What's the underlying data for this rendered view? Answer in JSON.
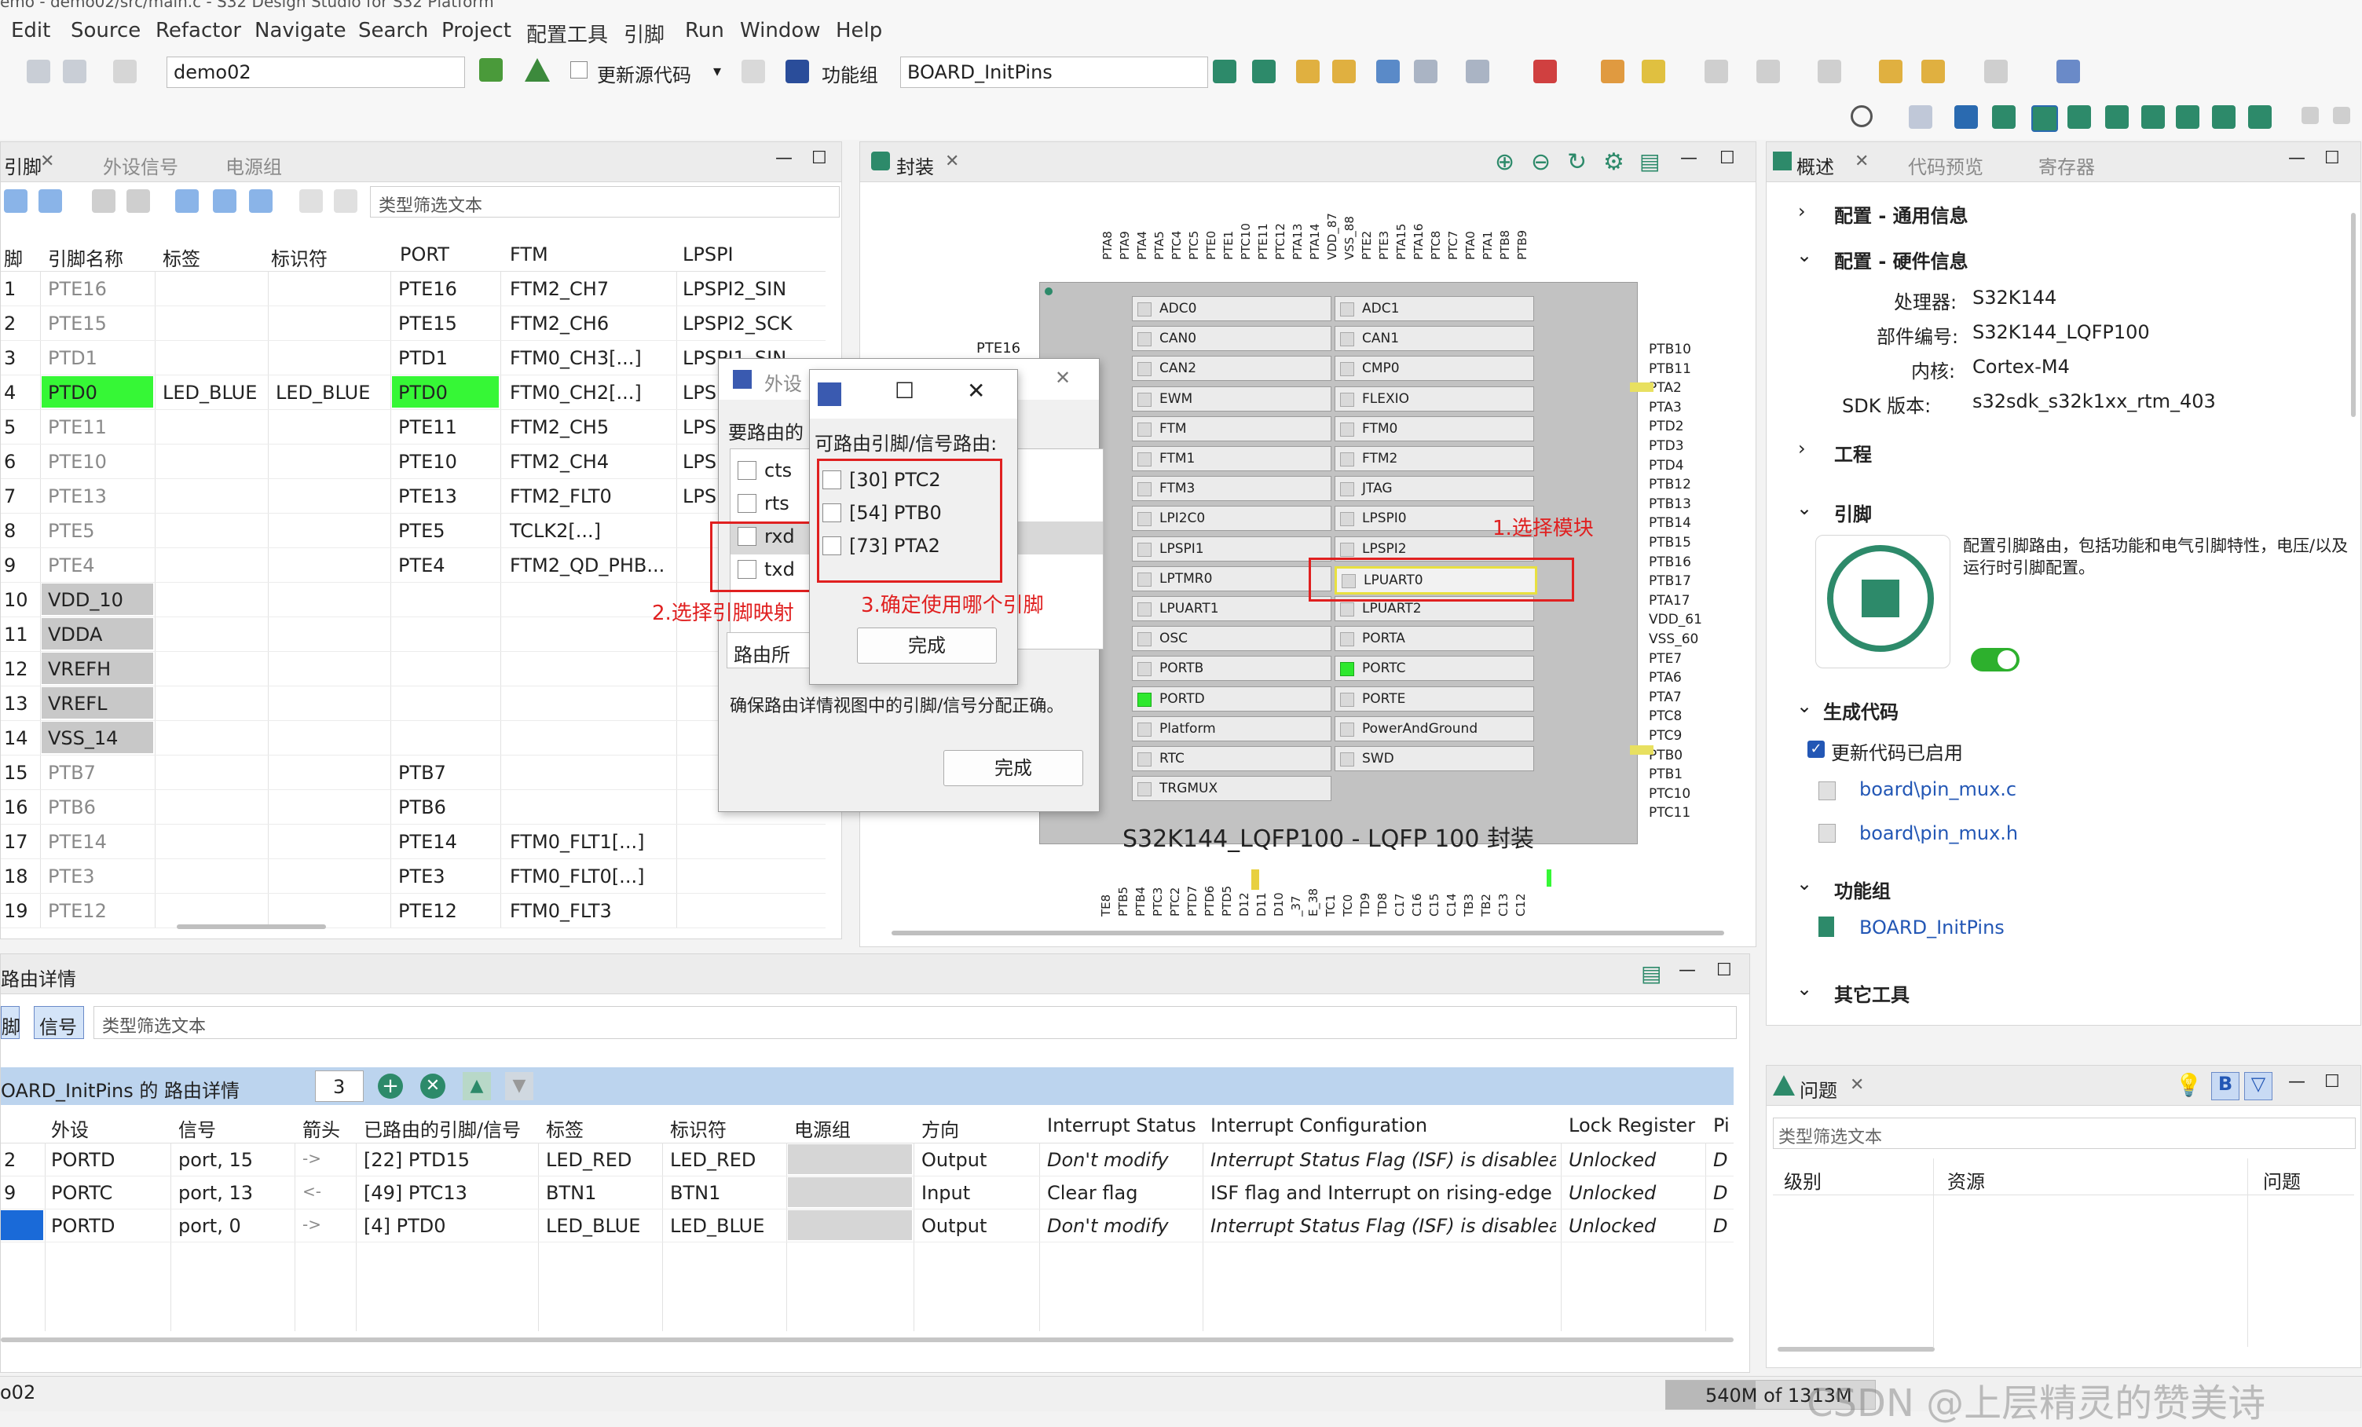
{
  "window": {
    "title": "emo - demo02/src/main.c - S32 Design Studio for S32 Platform"
  },
  "menu": [
    "Edit",
    "Source",
    "Refactor",
    "Navigate",
    "Search",
    "Project",
    "配置工具",
    "引脚",
    "Run",
    "Window",
    "Help"
  ],
  "toolbar": {
    "project": "demo02",
    "update_code": "更新源代码",
    "function_group_label": "功能组",
    "function_group": "BOARD_InitPins"
  },
  "pins_panel": {
    "tabs": [
      "引脚",
      "外设信号",
      "电源组"
    ],
    "filter_placeholder": "类型筛选文本",
    "columns": [
      "脚",
      "引脚名称",
      "标签",
      "标识符",
      "PORT",
      "FTM",
      "LPSPI"
    ],
    "rows": [
      {
        "n": "1",
        "name": "PTE16",
        "label": "",
        "id": "",
        "port": "PTE16",
        "ftm": "FTM2_CH7",
        "lpspi": "LPSPI2_SIN"
      },
      {
        "n": "2",
        "name": "PTE15",
        "label": "",
        "id": "",
        "port": "PTE15",
        "ftm": "FTM2_CH6",
        "lpspi": "LPSPI2_SCK"
      },
      {
        "n": "3",
        "name": "PTD1",
        "label": "",
        "id": "",
        "port": "PTD1",
        "ftm": "FTM0_CH3[...]",
        "lpspi": "LPSPI1_SIN"
      },
      {
        "n": "4",
        "name": "PTD0",
        "label": "LED_BLUE",
        "id": "LED_BLUE",
        "port": "PTD0",
        "ftm": "FTM0_CH2[...]",
        "lpspi": "LPSP"
      },
      {
        "n": "5",
        "name": "PTE11",
        "label": "",
        "id": "",
        "port": "PTE11",
        "ftm": "FTM2_CH5",
        "lpspi": "LPSP"
      },
      {
        "n": "6",
        "name": "PTE10",
        "label": "",
        "id": "",
        "port": "PTE10",
        "ftm": "FTM2_CH4",
        "lpspi": "LPSP"
      },
      {
        "n": "7",
        "name": "PTE13",
        "label": "",
        "id": "",
        "port": "PTE13",
        "ftm": "FTM2_FLT0",
        "lpspi": "LPSP"
      },
      {
        "n": "8",
        "name": "PTE5",
        "label": "",
        "id": "",
        "port": "PTE5",
        "ftm": "TCLK2[...]",
        "lpspi": ""
      },
      {
        "n": "9",
        "name": "PTE4",
        "label": "",
        "id": "",
        "port": "PTE4",
        "ftm": "FTM2_QD_PHB...",
        "lpspi": ""
      },
      {
        "n": "10",
        "name": "VDD_10",
        "label": "",
        "id": "",
        "port": "",
        "ftm": "",
        "lpspi": ""
      },
      {
        "n": "11",
        "name": "VDDA",
        "label": "",
        "id": "",
        "port": "",
        "ftm": "",
        "lpspi": ""
      },
      {
        "n": "12",
        "name": "VREFH",
        "label": "",
        "id": "",
        "port": "",
        "ftm": "",
        "lpspi": ""
      },
      {
        "n": "13",
        "name": "VREFL",
        "label": "",
        "id": "",
        "port": "",
        "ftm": "",
        "lpspi": ""
      },
      {
        "n": "14",
        "name": "VSS_14",
        "label": "",
        "id": "",
        "port": "",
        "ftm": "",
        "lpspi": ""
      },
      {
        "n": "15",
        "name": "PTB7",
        "label": "",
        "id": "",
        "port": "PTB7",
        "ftm": "",
        "lpspi": ""
      },
      {
        "n": "16",
        "name": "PTB6",
        "label": "",
        "id": "",
        "port": "PTB6",
        "ftm": "",
        "lpspi": ""
      },
      {
        "n": "17",
        "name": "PTE14",
        "label": "",
        "id": "",
        "port": "PTE14",
        "ftm": "FTM0_FLT1[...]",
        "lpspi": ""
      },
      {
        "n": "18",
        "name": "PTE3",
        "label": "",
        "id": "",
        "port": "PTE3",
        "ftm": "FTM0_FLT0[...]",
        "lpspi": ""
      },
      {
        "n": "19",
        "name": "PTE12",
        "label": "",
        "id": "",
        "port": "PTE12",
        "ftm": "FTM0_FLT3",
        "lpspi": ""
      }
    ]
  },
  "package_panel": {
    "tab": "封装",
    "package_title": "S32K144_LQFP100 - LQFP 100 封装",
    "top_pins": [
      "PTA8",
      "PTA9",
      "PTA4",
      "PTA5",
      "PTC4",
      "PTC5",
      "PTE0",
      "PTE1",
      "PTC10",
      "PTE11",
      "PTC12",
      "PTA13",
      "PTA14",
      "VDD_87",
      "VSS_88",
      "PTE2",
      "PTE3",
      "PTA15",
      "PTA16",
      "PTC8",
      "PTC7",
      "PTA0",
      "PTA1",
      "PTB8",
      "PTB9"
    ],
    "bottom_pins": [
      "TE8",
      "PTB5",
      "PTB4",
      "PTC3",
      "PTC2",
      "PTD7",
      "PTD6",
      "PTD5",
      "D12",
      "D11",
      "D10",
      "_37",
      "E_38",
      "TC1",
      "TC0",
      "TD9",
      "TD8",
      "C17",
      "C16",
      "C15",
      "C14",
      "TB3",
      "TB2",
      "C13",
      "C12"
    ],
    "right_pins": [
      "PTB10",
      "PTB11",
      "PTA2",
      "PTA3",
      "PTD2",
      "PTD3",
      "PTD4",
      "PTB12",
      "PTB13",
      "PTB14",
      "PTB15",
      "PTB16",
      "PTB17",
      "PTA17",
      "VDD_61",
      "VSS_60",
      "PTE7",
      "PTA6",
      "PTA7",
      "PTC8",
      "PTC9",
      "PTB0",
      "PTB1",
      "PTC10",
      "PTC11"
    ],
    "left_pin": "PTE16",
    "modules_left": [
      "ADC0",
      "CAN0",
      "CAN2",
      "EWM",
      "FTM",
      "FTM1",
      "FTM3",
      "LPI2C0",
      "LPSPI1",
      "LPTMR0",
      "LPUART1",
      "OSC",
      "PORTB",
      "PORTD",
      "Platform",
      "RTC",
      "TRGMUX"
    ],
    "modules_right": [
      "ADC1",
      "CAN1",
      "CMP0",
      "FLEXIO",
      "FTM0",
      "FTM2",
      "JTAG",
      "LPSPI0",
      "LPSPI2",
      "LPUART0",
      "LPUART2",
      "PORTA",
      "PORTC",
      "PORTE",
      "PowerAndGround",
      "SWD"
    ]
  },
  "annotations": {
    "step1": "1.选择模块",
    "step2": "2.选择引脚映射",
    "step3": "3.确定使用哪个引脚"
  },
  "dialog_signals": {
    "title": "外设",
    "prompt": "要路由的",
    "signals": [
      "cts",
      "rts",
      "rxd",
      "txd"
    ],
    "route_label": "路由所",
    "hint": "确保路由详情视图中的引脚/信号分配正确。",
    "done": "完成"
  },
  "dialog_pins": {
    "prompt": "可路由引脚/信号路由:",
    "options": [
      "[30] PTC2",
      "[54] PTB0",
      "[73] PTA2"
    ],
    "done": "完成"
  },
  "overview_panel": {
    "tabs": [
      "概述",
      "代码预览",
      "寄存器"
    ],
    "sections": {
      "general": "配置 - 通用信息",
      "hardware": "配置 - 硬件信息",
      "project": "工程",
      "pins": "引脚",
      "gen_code": "生成代码",
      "func_group": "功能组",
      "other_tools": "其它工具"
    },
    "hw": [
      {
        "k": "处理器:",
        "v": "S32K144"
      },
      {
        "k": "部件编号:",
        "v": "S32K144_LQFP100"
      },
      {
        "k": "内核:",
        "v": "Cortex-M4"
      },
      {
        "k": "SDK 版本:",
        "v": "s32sdk_s32k1xx_rtm_403"
      }
    ],
    "pins_desc": "配置引脚路由，包括功能和电气引脚特性，电压/以及运行时引脚配置。",
    "gen_enabled": "更新代码已启用",
    "files": [
      "board\\pin_mux.c",
      "board\\pin_mux.h"
    ],
    "func_group": "BOARD_InitPins"
  },
  "problems_panel": {
    "tab": "问题",
    "filter_placeholder": "类型筛选文本",
    "columns": [
      "级别",
      "资源",
      "问题"
    ]
  },
  "routing_panel": {
    "title": "路由详情",
    "tabs": [
      "脚",
      "信号"
    ],
    "filter_placeholder": "类型筛选文本",
    "header": "OARD_InitPins 的 路由详情",
    "count": "3",
    "columns": [
      "外设",
      "信号",
      "箭头",
      "已路由的引脚/信号",
      "标签",
      "标识符",
      "电源组",
      "方向",
      "Interrupt Status",
      "Interrupt Configuration",
      "Lock Register",
      "Pi"
    ],
    "rows": [
      {
        "n": "2",
        "periph": "PORTD",
        "signal": "port, 15",
        "arrow": "->",
        "routed": "[22] PTD15",
        "label": "LED_RED",
        "id": "LED_RED",
        "dir": "Output",
        "istat": "Don't modify",
        "icfg": "Interrupt Status Flag (ISF) is disablea",
        "lock": "Unlocked",
        "pi": "D"
      },
      {
        "n": "9",
        "periph": "PORTC",
        "signal": "port, 13",
        "arrow": "<-",
        "routed": "[49] PTC13",
        "label": "BTN1",
        "id": "BTN1",
        "dir": "Input",
        "istat": "Clear flag",
        "icfg": "ISF flag and Interrupt on rising-edge",
        "lock": "Unlocked",
        "pi": "D"
      },
      {
        "n": "",
        "periph": "PORTD",
        "signal": "port, 0",
        "arrow": "->",
        "routed": "[4] PTD0",
        "label": "LED_BLUE",
        "id": "LED_BLUE",
        "dir": "Output",
        "istat": "Don't modify",
        "icfg": "Interrupt Status Flag (ISF) is disablea",
        "lock": "Unlocked",
        "pi": "D"
      }
    ]
  },
  "status": {
    "left": "o02",
    "memory": "540M of 1313M",
    "watermark": "CSDN @上层精灵的赞美诗"
  },
  "colors": {
    "accent": "#2357b5",
    "active_pin": "#36f736",
    "annotation": "#e02020"
  }
}
